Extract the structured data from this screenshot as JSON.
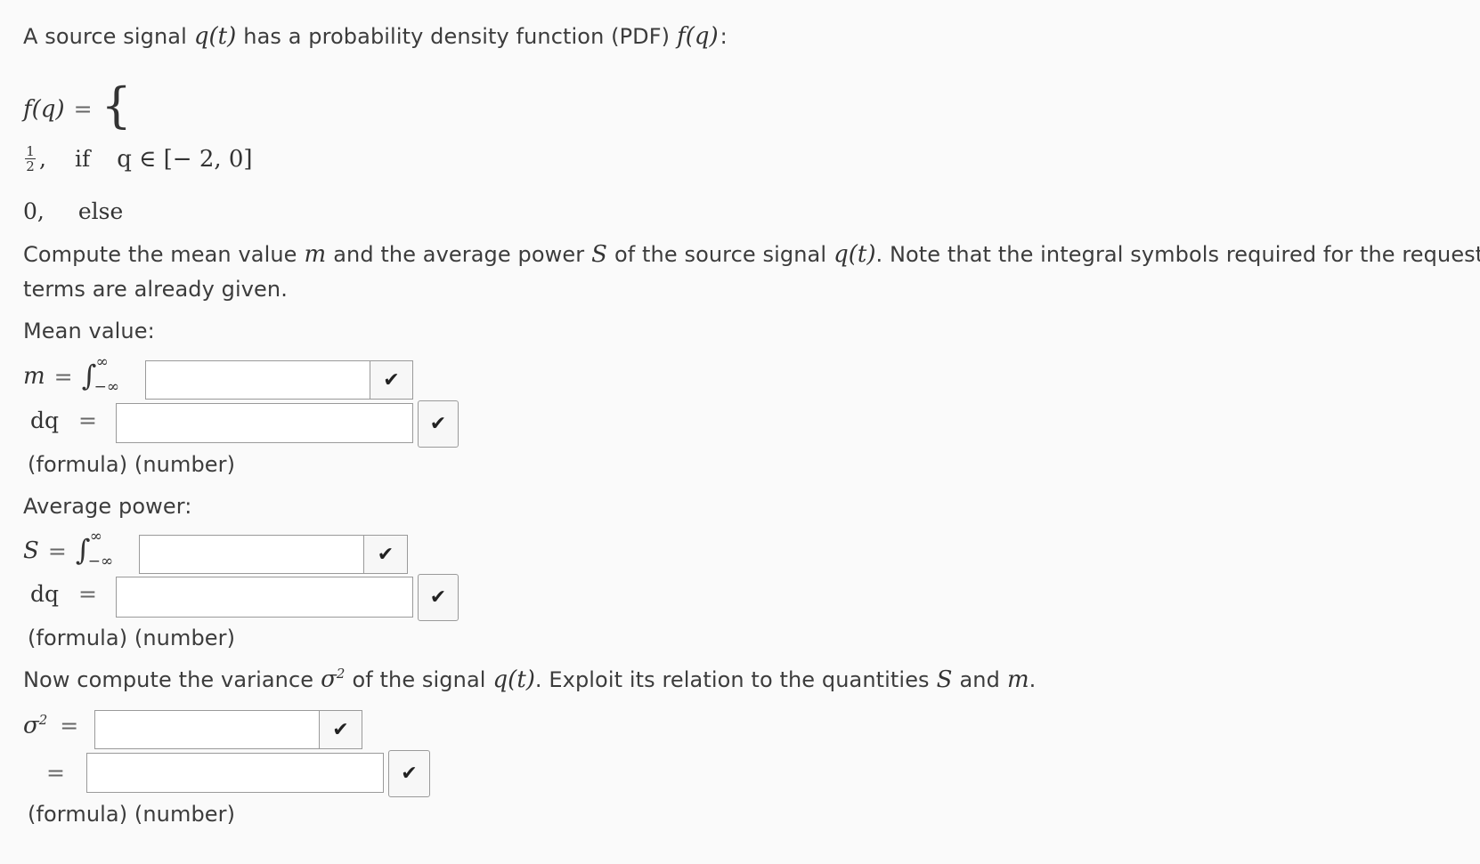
{
  "intro": {
    "text_a": "A source signal",
    "q_of_t": "q(t)",
    "text_b": "has a probability density function (PDF)",
    "f_of_q": "f(q)",
    "colon": ":"
  },
  "pdf": {
    "lhs": "f(q)",
    "eq": "=",
    "brace": "{",
    "case1_num": "1",
    "case1_den": "2",
    "case1_comma": ",",
    "case1_if": "if",
    "case1_cond": "q ∈ [− 2,  0]",
    "case2_val": "0,",
    "case2_else": "else"
  },
  "task": {
    "text_a": "Compute the mean value",
    "m": "m",
    "text_b": "and the average power",
    "S": "S",
    "text_c": "of the source signal",
    "q_of_t": "q(t)",
    "text_d": ". Note that the integral symbols required for the requested",
    "line2": "terms are already given."
  },
  "mean": {
    "heading": "Mean value:",
    "lhs": "m",
    "eq": "=",
    "integral": "∫",
    "upper": "∞",
    "lower": "−∞",
    "dq": "dq",
    "eq2": "=",
    "hints": "(formula) (number)"
  },
  "power": {
    "heading": "Average power:",
    "lhs": "S",
    "eq": "=",
    "integral": "∫",
    "upper": "∞",
    "lower": "−∞",
    "dq": "dq",
    "eq2": "=",
    "hints": "(formula) (number)"
  },
  "variance_task": {
    "text_a": "Now compute the variance",
    "sigma": "σ",
    "sup": "2",
    "text_b": "of the signal",
    "q_of_t": "q(t)",
    "text_c": ". Exploit its relation to the quantities",
    "S": "S",
    "text_d": "and",
    "m": "m",
    "dot": "."
  },
  "variance": {
    "sigma": "σ",
    "sup": "2",
    "eq": "=",
    "eq2": "=",
    "hints": "(formula) (number)"
  },
  "icons": {
    "check": "✔"
  }
}
